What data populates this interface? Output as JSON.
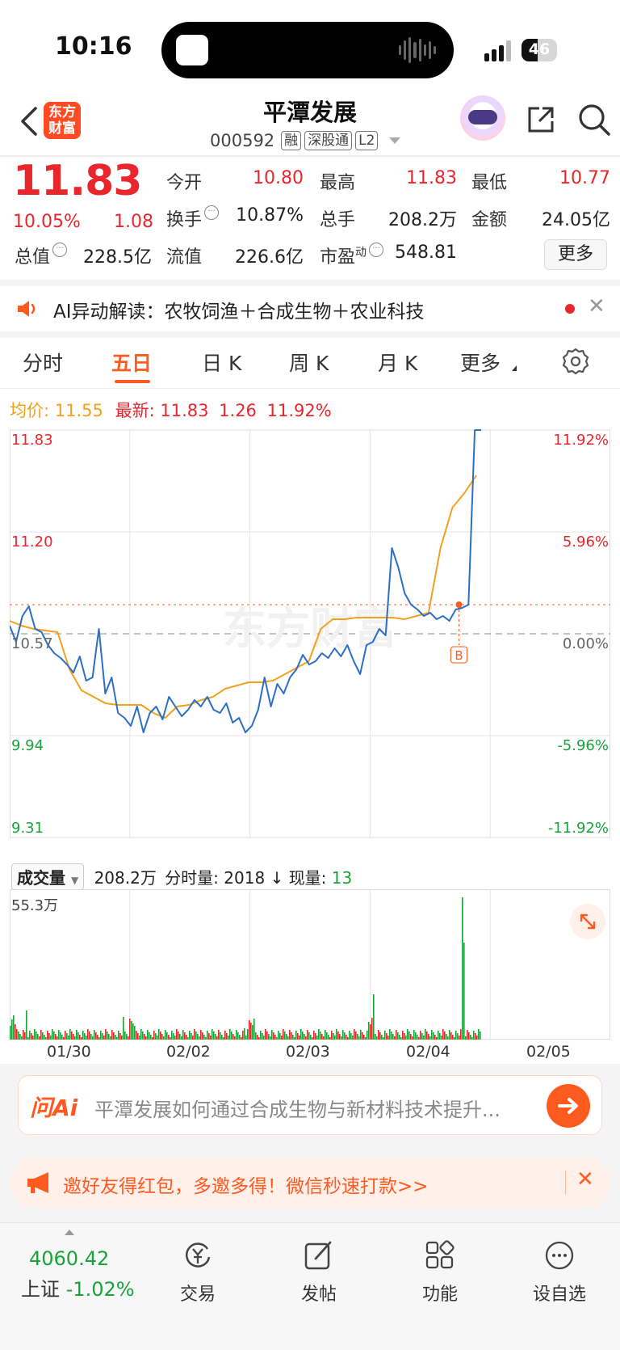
{
  "status": {
    "time": "10:16",
    "battery": "46"
  },
  "header": {
    "logo_line1": "东方",
    "logo_line2": "财富",
    "stock_name": "平潭发展",
    "stock_code": "000592",
    "tags": [
      "融",
      "深股通",
      "L2"
    ]
  },
  "quote": {
    "price": "11.83",
    "change_pct": "10.05%",
    "change_abs": "1.08",
    "open_label": "今开",
    "open": "10.80",
    "high_label": "最高",
    "high": "11.83",
    "low_label": "最低",
    "low": "10.77",
    "turnover_label": "换手",
    "turnover": "10.87%",
    "volume_label": "总手",
    "volume": "208.2万",
    "amount_label": "金额",
    "amount": "24.05亿",
    "mktcap_label": "总值",
    "mktcap": "228.5亿",
    "float_label": "流值",
    "float": "226.6亿",
    "pe_label": "市盈",
    "pe_sup": "动",
    "pe": "548.81",
    "more_button": "更多"
  },
  "ai_banner": {
    "text": "AI异动解读：农牧饲渔＋合成生物＋农业科技"
  },
  "tabs": {
    "items": [
      "分时",
      "五日",
      "日 K",
      "周 K",
      "月 K",
      "更多"
    ],
    "active": "五日"
  },
  "legend": {
    "avg_label": "均价:",
    "avg": "11.55",
    "latest_label": "最新:",
    "latest": "11.83",
    "change": "1.26",
    "change_pct": "11.92%"
  },
  "chart_data": {
    "type": "line",
    "title": "",
    "x": [
      "01/30",
      "02/02",
      "02/03",
      "02/04",
      "02/05"
    ],
    "y_ticks_left": [
      "11.83",
      "11.20",
      "10.57",
      "9.94",
      "9.31"
    ],
    "y_ticks_right": [
      "11.92%",
      "5.96%",
      "0.00%",
      "-5.96%",
      "-11.92%"
    ],
    "ylim": [
      9.31,
      11.83
    ],
    "prev_close": 10.57,
    "current_price": 10.75,
    "series": [
      {
        "values": [
          10.62,
          10.52,
          10.68,
          10.74,
          10.6,
          10.58,
          10.5,
          10.45,
          10.42,
          10.38,
          10.33,
          10.43,
          10.28,
          10.3,
          10.6,
          10.2,
          10.3,
          10.08,
          10.05,
          10.0,
          10.12,
          9.96,
          10.08,
          10.12,
          10.04,
          10.18,
          10.12,
          10.06,
          10.1,
          10.16,
          10.12,
          10.18,
          10.1,
          10.08,
          10.14,
          10.02,
          10.05,
          9.96,
          10.0,
          10.1,
          10.3,
          10.12,
          10.26,
          10.2,
          10.3,
          10.35,
          10.44,
          10.38,
          10.4,
          10.45,
          10.42,
          10.48,
          10.43,
          10.5,
          10.4,
          10.32,
          10.5,
          10.52,
          10.6,
          10.56,
          11.1,
          10.98,
          10.82,
          10.75,
          10.72,
          10.68,
          10.7,
          10.66,
          10.68,
          10.65,
          10.72,
          10.73,
          10.75,
          11.83,
          11.83
        ]
      },
      {
        "values": [
          10.65,
          10.62,
          10.6,
          10.59,
          10.58,
          10.35,
          10.22,
          10.18,
          10.14,
          10.13,
          10.13,
          10.13,
          10.08,
          10.05,
          10.12,
          10.13,
          10.16,
          10.18,
          10.23,
          10.25,
          10.27,
          10.27,
          10.28,
          10.32,
          10.36,
          10.4,
          10.6,
          10.66,
          10.66,
          10.67,
          10.67,
          10.67,
          10.67,
          10.66,
          10.68,
          10.7,
          11.1,
          11.35,
          11.44,
          11.55
        ]
      }
    ]
  },
  "volume": {
    "selector": "成交量",
    "total": "208.2万",
    "tick_label": "分时量:",
    "tick_value": "2018",
    "arrow": "↓",
    "now_label": "现量:",
    "now_value": "13",
    "max_label": "55.3万"
  },
  "ask_ai": {
    "logo": "问Ai",
    "placeholder": "平潭发展如何通过合成生物与新材料技术提升..."
  },
  "invite": {
    "text": "邀好友得红包，多邀多得！微信秒速打款>>"
  },
  "bottom_nav": {
    "index_value": "4060.42",
    "index_name": "上证",
    "index_change": "-1.02%",
    "items": [
      "交易",
      "发帖",
      "功能",
      "设自选"
    ]
  },
  "colors": {
    "up": "#e8262b",
    "down": "#19a33a",
    "accent": "#ff5a1f",
    "price_line": "#2c6fc5",
    "avg_line": "#f2a11e"
  }
}
